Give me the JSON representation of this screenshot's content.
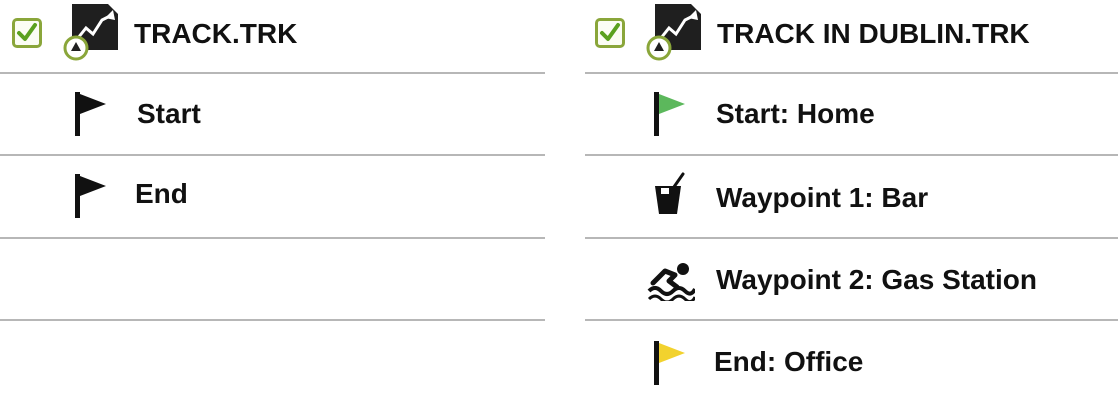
{
  "left_panel": {
    "track_name": "TRACK.TRK",
    "track_checked": true,
    "rows": [
      {
        "label": "Start",
        "icon": "flag-icon",
        "color": "#111111"
      },
      {
        "label": "End",
        "icon": "flag-icon",
        "color": "#111111"
      }
    ]
  },
  "right_panel": {
    "track_name": "TRACK IN DUBLIN.TRK",
    "track_checked": true,
    "rows": [
      {
        "label": "Start: Home",
        "icon": "flag-icon",
        "color": "#5cb85c"
      },
      {
        "label": "Waypoint 1: Bar",
        "icon": "cocktail-icon",
        "color": "#111111"
      },
      {
        "label": "Waypoint 2: Gas Station",
        "icon": "swimmer-icon",
        "color": "#111111"
      },
      {
        "label": "End: Office",
        "icon": "flag-icon",
        "color": "#f2d22e"
      }
    ]
  },
  "colors": {
    "checkbox_border": "#8aa63a",
    "checkmark": "#5aa11f",
    "divider": "#b7b7b7",
    "start_flag_green": "#5cb85c",
    "end_flag_yellow": "#f2d22e"
  }
}
